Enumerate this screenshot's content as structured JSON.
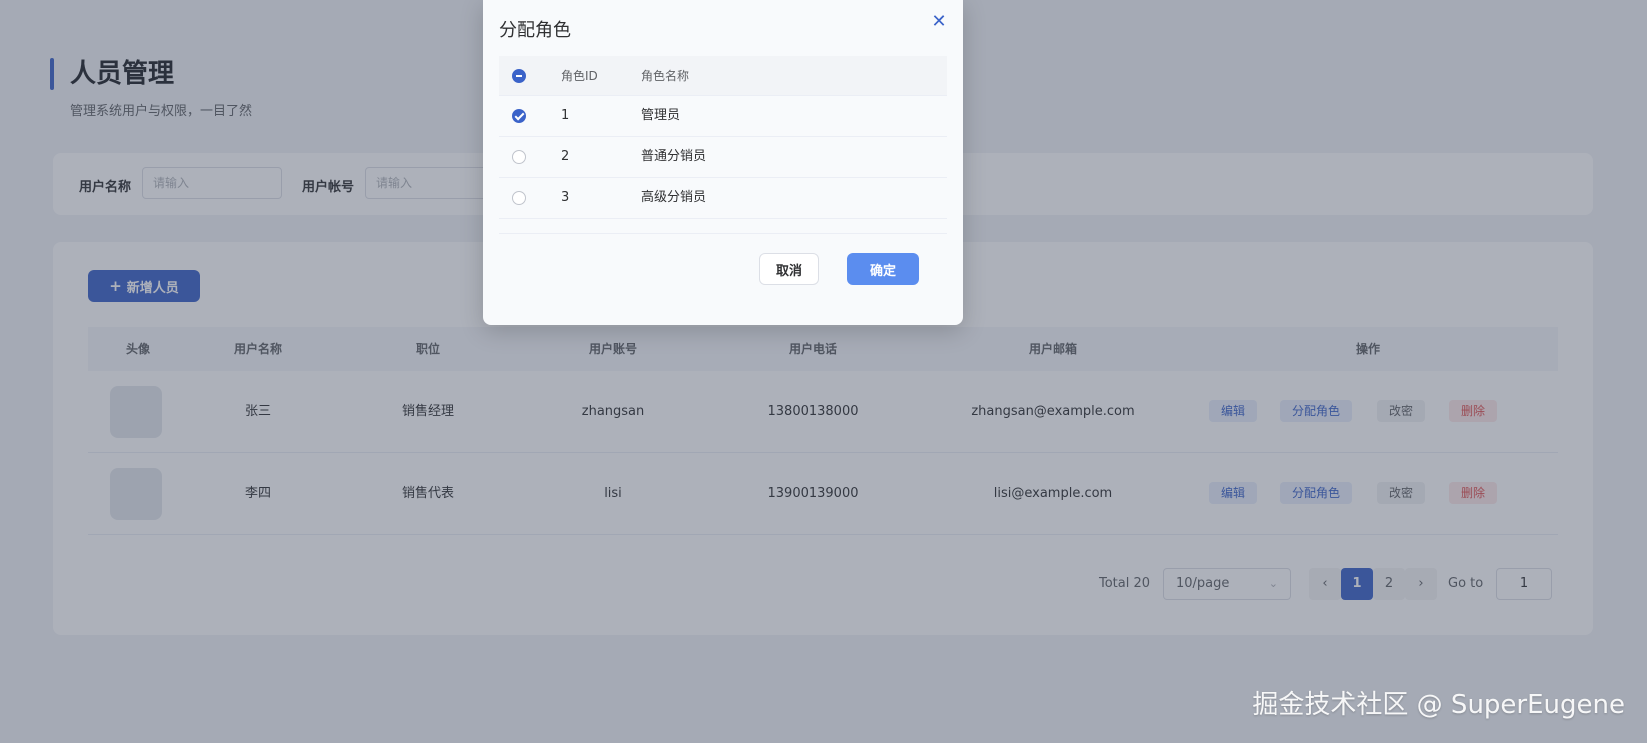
{
  "page": {
    "title": "人员管理",
    "subtitle": "管理系统用户与权限，一目了然"
  },
  "search": {
    "username_label": "用户名称",
    "username_placeholder": "请输入",
    "account_label": "用户帐号",
    "account_placeholder": "请输入"
  },
  "toolbar": {
    "add_icon": "plus-icon",
    "add_label": "新增人员"
  },
  "table": {
    "columns": [
      "头像",
      "用户名称",
      "职位",
      "用户账号",
      "用户电话",
      "用户邮箱",
      "操作"
    ],
    "rows": [
      {
        "name": "张三",
        "position": "销售经理",
        "account": "zhangsan",
        "phone": "13800138000",
        "email": "zhangsan@example.com"
      },
      {
        "name": "李四",
        "position": "销售代表",
        "account": "lisi",
        "phone": "13900139000",
        "email": "lisi@example.com"
      }
    ],
    "actions": {
      "edit": "编辑",
      "assign_role": "分配角色",
      "change_password": "改密",
      "delete": "删除"
    }
  },
  "pagination": {
    "total": "Total 20",
    "page_size": "10/page",
    "prev_icon": "chevron-left-icon",
    "next_icon": "chevron-right-icon",
    "pages": [
      "1",
      "2"
    ],
    "current_page": "1",
    "goto_label": "Go to",
    "goto_value": "1"
  },
  "dialog": {
    "title": "分配角色",
    "close_icon": "close-icon",
    "columns": {
      "id": "角色ID",
      "name": "角色名称"
    },
    "select_all_state": "indeterminate",
    "roles": [
      {
        "id": "1",
        "name": "管理员",
        "checked": true
      },
      {
        "id": "2",
        "name": "普通分销员",
        "checked": false
      },
      {
        "id": "3",
        "name": "高级分销员",
        "checked": false
      }
    ],
    "cancel_label": "取消",
    "confirm_label": "确定"
  },
  "colors": {
    "primary": "#3b63c9",
    "confirm": "#5b8def",
    "danger": "#e05252"
  },
  "watermark": "掘金技术社区 @ SuperEugene"
}
